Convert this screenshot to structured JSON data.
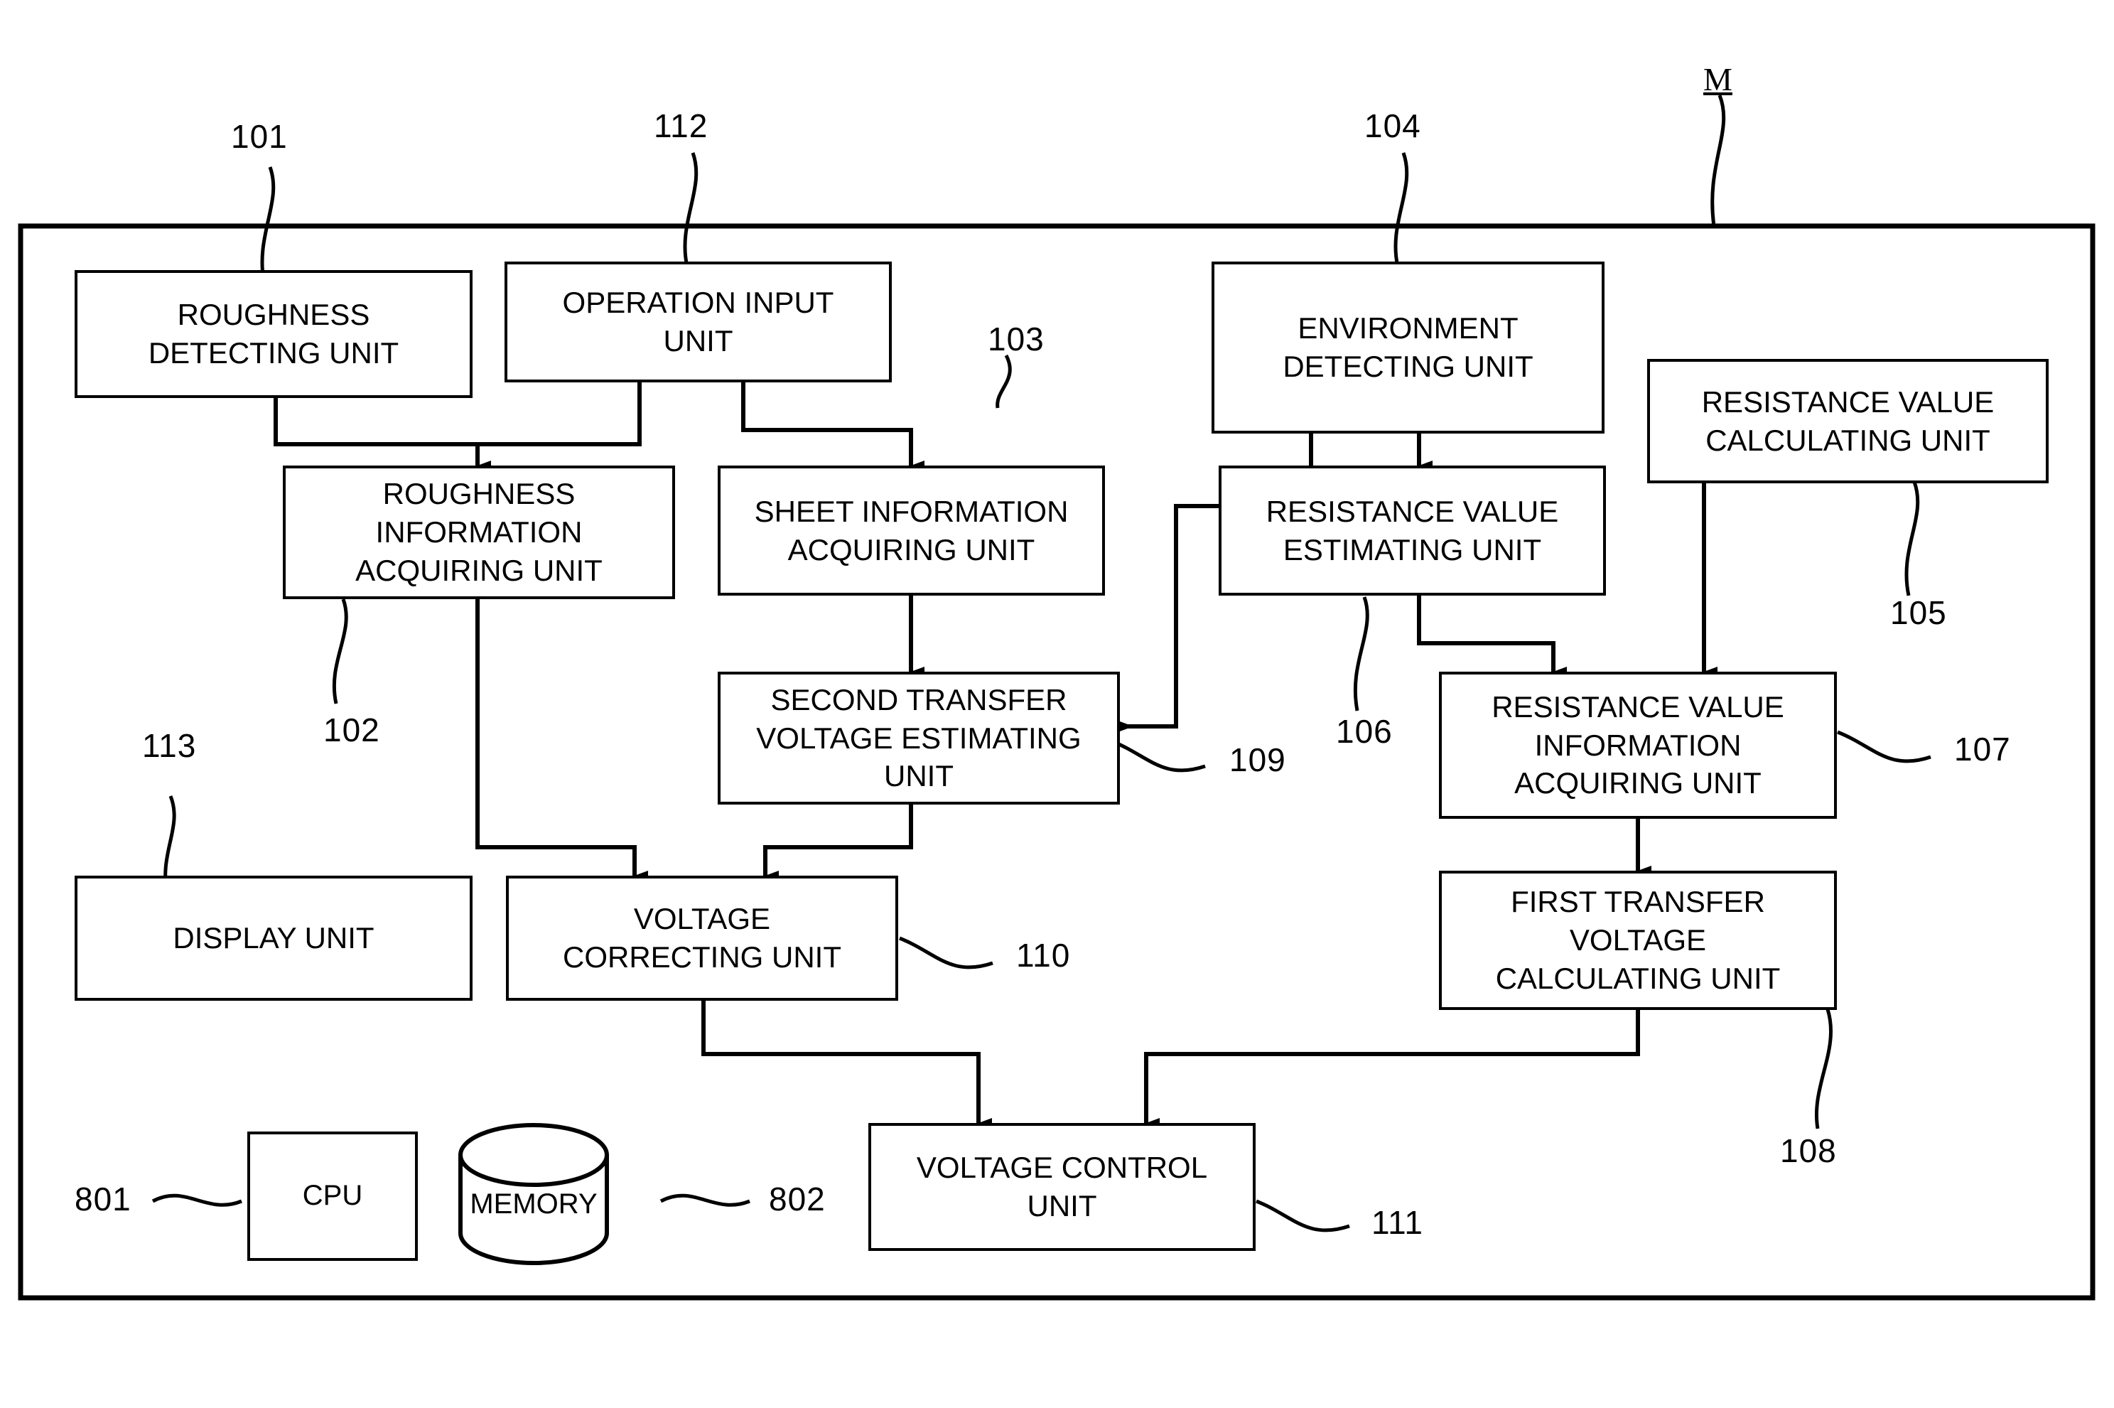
{
  "figure": {
    "system_label": "M",
    "boxes": [
      {
        "id": "roughness_detecting",
        "text": "ROUGHNESS\nDETECTING UNIT",
        "ref": "101"
      },
      {
        "id": "operation_input",
        "text": "OPERATION INPUT\nUNIT",
        "ref": "112"
      },
      {
        "id": "environment_detecting",
        "text": "ENVIRONMENT\nDETECTING UNIT",
        "ref": "104"
      },
      {
        "id": "resistance_value_calculating",
        "text": "RESISTANCE VALUE\nCALCULATING UNIT",
        "ref": "105"
      },
      {
        "id": "roughness_info_acquiring",
        "text": "ROUGHNESS\nINFORMATION\nACQUIRING UNIT",
        "ref": "102"
      },
      {
        "id": "sheet_info_acquiring",
        "text": "SHEET INFORMATION\nACQUIRING UNIT",
        "ref": "103"
      },
      {
        "id": "resistance_value_estimating",
        "text": "RESISTANCE VALUE\nESTIMATING UNIT",
        "ref": "106"
      },
      {
        "id": "second_transfer_voltage_estimating",
        "text": "SECOND TRANSFER\nVOLTAGE ESTIMATING\nUNIT",
        "ref": "109"
      },
      {
        "id": "resistance_value_info_acquiring",
        "text": "RESISTANCE VALUE\nINFORMATION\nACQUIRING UNIT",
        "ref": "107"
      },
      {
        "id": "display",
        "text": "DISPLAY UNIT",
        "ref": "113"
      },
      {
        "id": "voltage_correcting",
        "text": "VOLTAGE\nCORRECTING UNIT",
        "ref": "110"
      },
      {
        "id": "first_transfer_voltage_calculating",
        "text": "FIRST TRANSFER\nVOLTAGE\nCALCULATING UNIT",
        "ref": "108"
      },
      {
        "id": "cpu",
        "text": "CPU",
        "ref": "801"
      },
      {
        "id": "memory",
        "text": "MEMORY",
        "ref": "802"
      },
      {
        "id": "voltage_control",
        "text": "VOLTAGE CONTROL\nUNIT",
        "ref": "111"
      }
    ],
    "reference_numerals": [
      "101",
      "112",
      "104",
      "105",
      "103",
      "102",
      "113",
      "109",
      "106",
      "107",
      "110",
      "108",
      "801",
      "802",
      "111"
    ]
  }
}
